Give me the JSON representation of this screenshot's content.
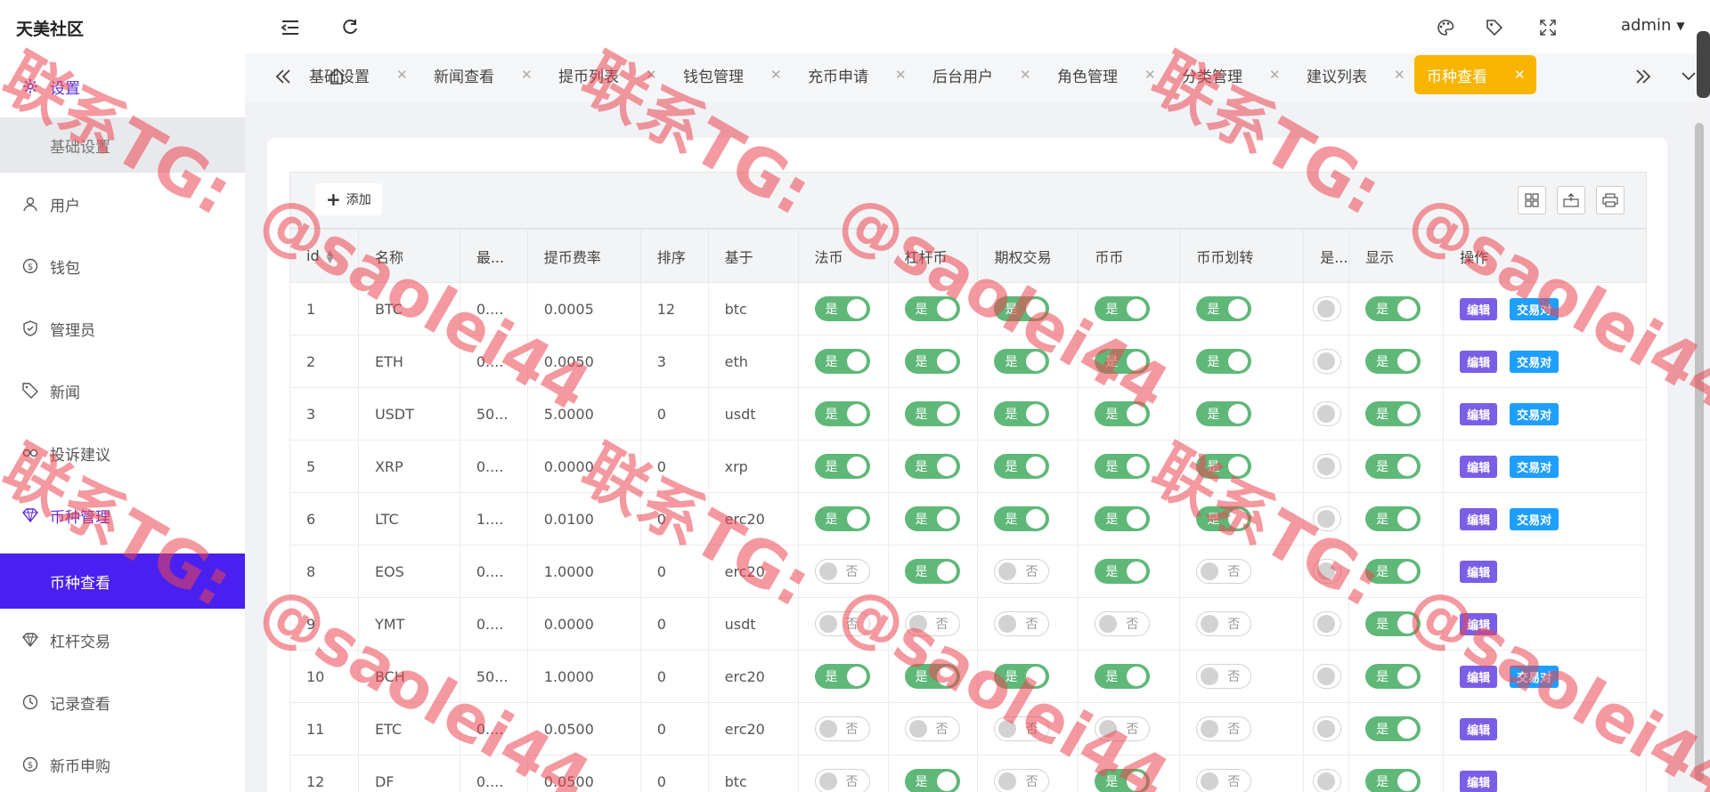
{
  "brand": "天美社区",
  "sidebar": {
    "items": [
      {
        "label": "设置",
        "icon": "gear-icon",
        "active": true
      },
      {
        "label": "基础设置",
        "sub": true
      },
      {
        "label": "用户",
        "icon": "user-icon"
      },
      {
        "label": "钱包",
        "icon": "dollar-icon"
      },
      {
        "label": "管理员",
        "icon": "shield-icon"
      },
      {
        "label": "新闻",
        "icon": "tag-icon"
      },
      {
        "label": "投诉建议",
        "icon": "link-icon"
      },
      {
        "label": "币种管理",
        "icon": "diamond-icon",
        "active": true
      },
      {
        "label": "币种查看",
        "sub": true,
        "selected": true
      },
      {
        "label": "杠杆交易",
        "icon": "diamond-icon"
      },
      {
        "label": "记录查看",
        "icon": "clock-icon"
      },
      {
        "label": "新币申购",
        "icon": "dollar-icon"
      }
    ]
  },
  "header": {
    "user": "admin"
  },
  "tabs": [
    {
      "label": "基础设置"
    },
    {
      "label": "新闻查看"
    },
    {
      "label": "提币列表"
    },
    {
      "label": "钱包管理"
    },
    {
      "label": "充币申请"
    },
    {
      "label": "后台用户"
    },
    {
      "label": "角色管理"
    },
    {
      "label": "分类管理"
    },
    {
      "label": "建议列表"
    },
    {
      "label": "币种查看",
      "active": true
    }
  ],
  "toolbar": {
    "add_label": "添加"
  },
  "table": {
    "columns": [
      "id",
      "名称",
      "最...",
      "提币费率",
      "排序",
      "基于",
      "法币",
      "杠杆币",
      "期权交易",
      "币币",
      "币币划转",
      "是...",
      "显示",
      "操作"
    ],
    "switch_on": "是",
    "switch_off": "否",
    "edit_label": "编辑",
    "pair_label": "交易对",
    "rows": [
      {
        "id": "1",
        "name": "BTC",
        "min": "0....",
        "fee": "0.0005",
        "sort": "12",
        "base": "btc",
        "fiat": true,
        "lever": true,
        "option": true,
        "coin": true,
        "transfer": true,
        "show": true,
        "pair": true
      },
      {
        "id": "2",
        "name": "ETH",
        "min": "0....",
        "fee": "0.0050",
        "sort": "3",
        "base": "eth",
        "fiat": true,
        "lever": true,
        "option": true,
        "coin": true,
        "transfer": true,
        "show": true,
        "pair": true
      },
      {
        "id": "3",
        "name": "USDT",
        "min": "50...",
        "fee": "5.0000",
        "sort": "0",
        "base": "usdt",
        "fiat": true,
        "lever": true,
        "option": true,
        "coin": true,
        "transfer": true,
        "show": true,
        "pair": true
      },
      {
        "id": "5",
        "name": "XRP",
        "min": "0....",
        "fee": "0.0000",
        "sort": "0",
        "base": "xrp",
        "fiat": true,
        "lever": true,
        "option": true,
        "coin": true,
        "transfer": true,
        "show": true,
        "pair": true
      },
      {
        "id": "6",
        "name": "LTC",
        "min": "1....",
        "fee": "0.0100",
        "sort": "0",
        "base": "erc20",
        "fiat": true,
        "lever": true,
        "option": true,
        "coin": true,
        "transfer": true,
        "show": true,
        "pair": true
      },
      {
        "id": "8",
        "name": "EOS",
        "min": "0....",
        "fee": "1.0000",
        "sort": "0",
        "base": "erc20",
        "fiat": false,
        "lever": true,
        "option": false,
        "coin": true,
        "transfer": false,
        "show": true,
        "pair": false
      },
      {
        "id": "9",
        "name": "YMT",
        "min": "0....",
        "fee": "0.0000",
        "sort": "0",
        "base": "usdt",
        "fiat": false,
        "lever": false,
        "option": false,
        "coin": false,
        "transfer": false,
        "show": true,
        "pair": false
      },
      {
        "id": "10",
        "name": "BCH",
        "min": "50...",
        "fee": "1.0000",
        "sort": "0",
        "base": "erc20",
        "fiat": true,
        "lever": true,
        "option": true,
        "coin": true,
        "transfer": false,
        "show": true,
        "pair": true
      },
      {
        "id": "11",
        "name": "ETC",
        "min": "0....",
        "fee": "0.0500",
        "sort": "0",
        "base": "erc20",
        "fiat": false,
        "lever": false,
        "option": false,
        "coin": false,
        "transfer": false,
        "show": true,
        "pair": false
      },
      {
        "id": "12",
        "name": "DF",
        "min": "0....",
        "fee": "0.0500",
        "sort": "0",
        "base": "btc",
        "fiat": false,
        "lever": true,
        "option": false,
        "coin": true,
        "transfer": false,
        "show": true,
        "pair": false
      }
    ]
  },
  "watermark": {
    "line1": "联系TG:",
    "line2": "@saolei44"
  },
  "colors": {
    "accent": "#5b2be0",
    "selected_bg": "#4a20f0",
    "active_tab": "#f7b500",
    "switch_on": "#5fb878",
    "edit_btn": "#7b5ee6",
    "pair_btn": "#1e9fff"
  }
}
